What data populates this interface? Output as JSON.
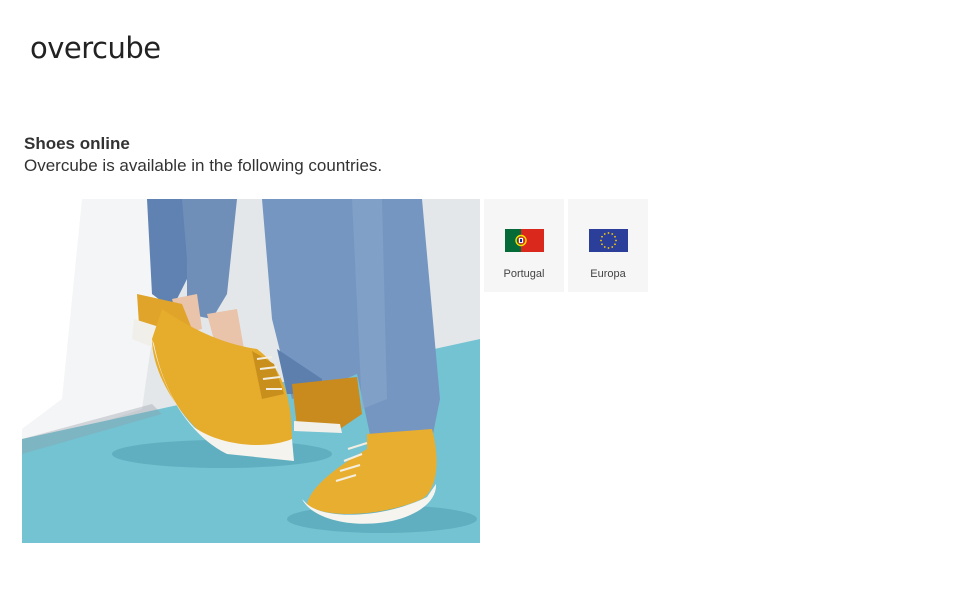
{
  "header": {
    "logo_text": "overcube"
  },
  "main": {
    "heading": "Shoes online",
    "subtitle": "Overcube is available in the following countries.",
    "hero_image": "yellow-sneakers-photo",
    "countries": [
      {
        "label": "Portugal",
        "flag": "portugal-flag-icon"
      },
      {
        "label": "Europa",
        "flag": "eu-flag-icon"
      }
    ]
  },
  "colors": {
    "background": "#ffffff",
    "text": "#333333",
    "tile_background": "#f6f6f6",
    "floor_teal": "#74c3d3",
    "shoe_yellow": "#e3aa2e",
    "denim": "#6f8fb8"
  }
}
